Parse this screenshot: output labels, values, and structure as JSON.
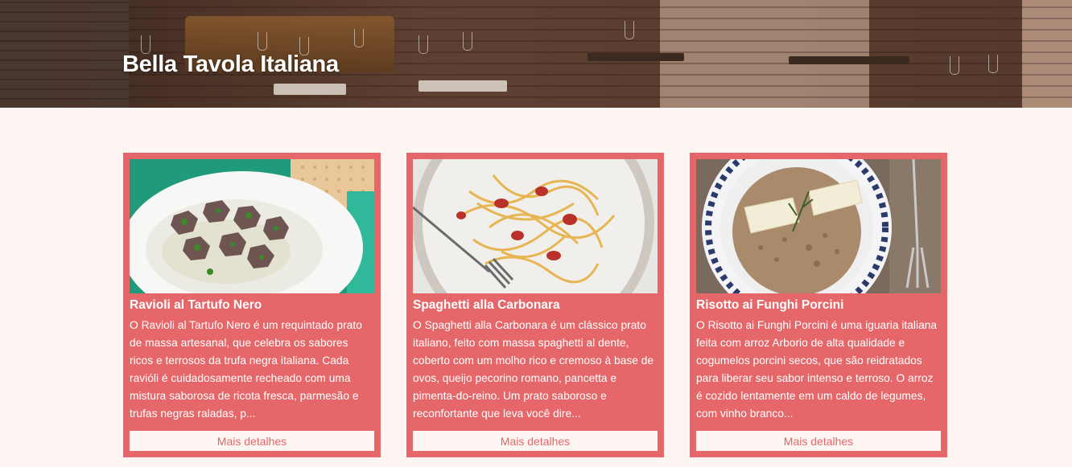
{
  "hero": {
    "title": "Bella Tavola Italiana",
    "background_image": "restaurant-interior-image"
  },
  "colors": {
    "accent": "#e5676a",
    "page_bg": "#fdf6f2",
    "card_text": "#ffffff"
  },
  "cards": [
    {
      "image": "ravioli-dish-image",
      "title": "Ravioli al Tartufo Nero",
      "description": "O Ravioli al Tartufo Nero é um requintado prato de massa artesanal, que celebra os sabores ricos e terrosos da trufa negra italiana. Cada raviól​i é cuidadosamente recheado com uma mistura saborosa de ricota fresca, parmesão e trufas negras raladas, p...",
      "button_label": "Mais detalhes"
    },
    {
      "image": "carbonara-dish-image",
      "title": "Spaghetti alla Carbonara",
      "description": "O Spaghetti alla Carbonara é um clássico prato italiano, feito com massa spaghetti al dente, coberto com um molho rico e cremoso à base de ovos, queijo pecorino romano, pancetta e pimenta-do-reino. Um prato saboroso e reconfortante que leva você dire...",
      "button_label": "Mais detalhes"
    },
    {
      "image": "risotto-dish-image",
      "title": "Risotto ai Funghi Porcini",
      "description": "O Risotto ai Funghi Porcini é uma iguaria italiana feita com arroz Arborio de alta qualidade e cogumelos porcini secos, que são reidratados para liberar seu sabor intenso e terroso. O arroz é cozido lentamente em um caldo de legumes, com vinho branco...",
      "button_label": "Mais detalhes"
    }
  ]
}
